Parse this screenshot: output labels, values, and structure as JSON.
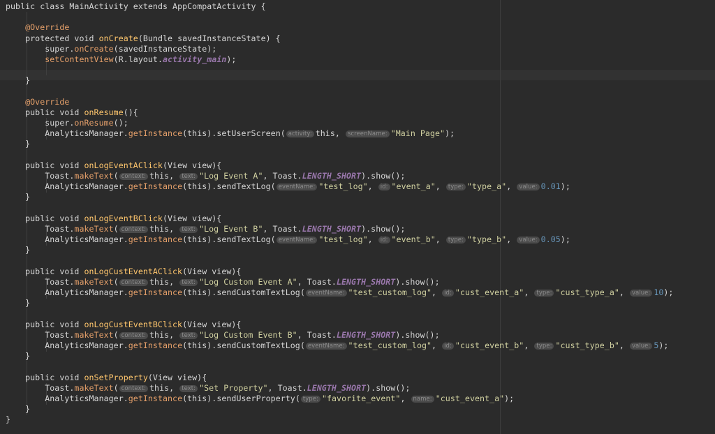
{
  "editor": {
    "lines": [
      [
        {
          "t": "public class ",
          "c": "kw"
        },
        {
          "t": "MainActivity",
          "c": "plain"
        },
        {
          "t": " extends ",
          "c": "kw"
        },
        {
          "t": "AppCompatActivity",
          "c": "plain"
        },
        {
          "t": " {",
          "c": "plain"
        }
      ],
      [],
      [
        {
          "t": "    "
        },
        {
          "t": "@Override",
          "c": "orange"
        }
      ],
      [
        {
          "t": "    protected void ",
          "c": "kw"
        },
        {
          "t": "onCreate",
          "c": "mth"
        },
        {
          "t": "(Bundle savedInstanceState) {",
          "c": "plain"
        }
      ],
      [
        {
          "t": "        super.",
          "c": "plain"
        },
        {
          "t": "onCreate",
          "c": "orange"
        },
        {
          "t": "(savedInstanceState);",
          "c": "plain"
        }
      ],
      [
        {
          "t": "        "
        },
        {
          "t": "setContentView",
          "c": "orange"
        },
        {
          "t": "(R.layout.",
          "c": "plain"
        },
        {
          "t": "activity_main",
          "c": "field"
        },
        {
          "t": ");",
          "c": "plain"
        }
      ],
      [],
      [
        {
          "t": "    }",
          "c": "plain"
        }
      ],
      [],
      [
        {
          "t": "    "
        },
        {
          "t": "@Override",
          "c": "orange"
        }
      ],
      [
        {
          "t": "    public void ",
          "c": "kw"
        },
        {
          "t": "onResume",
          "c": "mth"
        },
        {
          "t": "(){",
          "c": "plain"
        }
      ],
      [
        {
          "t": "        super.",
          "c": "plain"
        },
        {
          "t": "onResume",
          "c": "orange"
        },
        {
          "t": "();",
          "c": "plain"
        }
      ],
      [
        {
          "t": "        AnalyticsManager.",
          "c": "plain"
        },
        {
          "t": "getInstance",
          "c": "orange"
        },
        {
          "t": "(this).",
          "c": "plain"
        },
        {
          "t": "setUserScreen",
          "c": "plain"
        },
        {
          "t": "(",
          "c": "plain"
        },
        {
          "h": "activity:"
        },
        {
          "t": "this, ",
          "c": "plain"
        },
        {
          "h": "screenName:"
        },
        {
          "t": "\"Main Page\"",
          "c": "str"
        },
        {
          "t": ");",
          "c": "plain"
        }
      ],
      [
        {
          "t": "    }",
          "c": "plain"
        }
      ],
      [],
      [
        {
          "t": "    public void ",
          "c": "kw"
        },
        {
          "t": "onLogEventAClick",
          "c": "mth"
        },
        {
          "t": "(View view){",
          "c": "plain"
        }
      ],
      [
        {
          "t": "        Toast.",
          "c": "plain"
        },
        {
          "t": "makeText",
          "c": "orange"
        },
        {
          "t": "(",
          "c": "plain"
        },
        {
          "h": "context:"
        },
        {
          "t": "this, ",
          "c": "plain"
        },
        {
          "h": "text:"
        },
        {
          "t": "\"Log Event A\"",
          "c": "str"
        },
        {
          "t": ", Toast.",
          "c": "plain"
        },
        {
          "t": "LENGTH_SHORT",
          "c": "field"
        },
        {
          "t": ").show();",
          "c": "plain"
        }
      ],
      [
        {
          "t": "        AnalyticsManager.",
          "c": "plain"
        },
        {
          "t": "getInstance",
          "c": "orange"
        },
        {
          "t": "(this).",
          "c": "plain"
        },
        {
          "t": "sendTextLog",
          "c": "plain"
        },
        {
          "t": "(",
          "c": "plain"
        },
        {
          "h": "eventName:"
        },
        {
          "t": "\"test_log\"",
          "c": "str"
        },
        {
          "t": ", ",
          "c": "plain"
        },
        {
          "h": "id:"
        },
        {
          "t": "\"event_a\"",
          "c": "str"
        },
        {
          "t": ", ",
          "c": "plain"
        },
        {
          "h": "type:"
        },
        {
          "t": "\"type_a\"",
          "c": "str"
        },
        {
          "t": ", ",
          "c": "plain"
        },
        {
          "h": "value:"
        },
        {
          "t": "0.01",
          "c": "num"
        },
        {
          "t": ");",
          "c": "plain"
        }
      ],
      [
        {
          "t": "    }",
          "c": "plain"
        }
      ],
      [],
      [
        {
          "t": "    public void ",
          "c": "kw"
        },
        {
          "t": "onLogEventBClick",
          "c": "mth"
        },
        {
          "t": "(View view){",
          "c": "plain"
        }
      ],
      [
        {
          "t": "        Toast.",
          "c": "plain"
        },
        {
          "t": "makeText",
          "c": "orange"
        },
        {
          "t": "(",
          "c": "plain"
        },
        {
          "h": "context:"
        },
        {
          "t": "this, ",
          "c": "plain"
        },
        {
          "h": "text:"
        },
        {
          "t": "\"Log Event B\"",
          "c": "str"
        },
        {
          "t": ", Toast.",
          "c": "plain"
        },
        {
          "t": "LENGTH_SHORT",
          "c": "field"
        },
        {
          "t": ").show();",
          "c": "plain"
        }
      ],
      [
        {
          "t": "        AnalyticsManager.",
          "c": "plain"
        },
        {
          "t": "getInstance",
          "c": "orange"
        },
        {
          "t": "(this).",
          "c": "plain"
        },
        {
          "t": "sendTextLog",
          "c": "plain"
        },
        {
          "t": "(",
          "c": "plain"
        },
        {
          "h": "eventName:"
        },
        {
          "t": "\"test_log\"",
          "c": "str"
        },
        {
          "t": ", ",
          "c": "plain"
        },
        {
          "h": "id:"
        },
        {
          "t": "\"event_b\"",
          "c": "str"
        },
        {
          "t": ", ",
          "c": "plain"
        },
        {
          "h": "type:"
        },
        {
          "t": "\"type_b\"",
          "c": "str"
        },
        {
          "t": ", ",
          "c": "plain"
        },
        {
          "h": "value:"
        },
        {
          "t": "0.05",
          "c": "num"
        },
        {
          "t": ");",
          "c": "plain"
        }
      ],
      [
        {
          "t": "    }",
          "c": "plain"
        }
      ],
      [],
      [
        {
          "t": "    public void ",
          "c": "kw"
        },
        {
          "t": "onLogCustEventAClick",
          "c": "mth"
        },
        {
          "t": "(View view){",
          "c": "plain"
        }
      ],
      [
        {
          "t": "        Toast.",
          "c": "plain"
        },
        {
          "t": "makeText",
          "c": "orange"
        },
        {
          "t": "(",
          "c": "plain"
        },
        {
          "h": "context:"
        },
        {
          "t": "this, ",
          "c": "plain"
        },
        {
          "h": "text:"
        },
        {
          "t": "\"Log Custom Event A\"",
          "c": "str"
        },
        {
          "t": ", Toast.",
          "c": "plain"
        },
        {
          "t": "LENGTH_SHORT",
          "c": "field"
        },
        {
          "t": ").show();",
          "c": "plain"
        }
      ],
      [
        {
          "t": "        AnalyticsManager.",
          "c": "plain"
        },
        {
          "t": "getInstance",
          "c": "orange"
        },
        {
          "t": "(this).",
          "c": "plain"
        },
        {
          "t": "sendCustomTextLog",
          "c": "plain"
        },
        {
          "t": "(",
          "c": "plain"
        },
        {
          "h": "eventName:"
        },
        {
          "t": "\"test_custom_log\"",
          "c": "str"
        },
        {
          "t": ", ",
          "c": "plain"
        },
        {
          "h": "id:"
        },
        {
          "t": "\"cust_event_a\"",
          "c": "str"
        },
        {
          "t": ", ",
          "c": "plain"
        },
        {
          "h": "type:"
        },
        {
          "t": "\"cust_type_a\"",
          "c": "str"
        },
        {
          "t": ", ",
          "c": "plain"
        },
        {
          "h": "value:"
        },
        {
          "t": "10",
          "c": "num"
        },
        {
          "t": ");",
          "c": "plain"
        }
      ],
      [
        {
          "t": "    }",
          "c": "plain"
        }
      ],
      [],
      [
        {
          "t": "    public void ",
          "c": "kw"
        },
        {
          "t": "onLogCustEventBClick",
          "c": "mth"
        },
        {
          "t": "(View view){",
          "c": "plain"
        }
      ],
      [
        {
          "t": "        Toast.",
          "c": "plain"
        },
        {
          "t": "makeText",
          "c": "orange"
        },
        {
          "t": "(",
          "c": "plain"
        },
        {
          "h": "context:"
        },
        {
          "t": "this, ",
          "c": "plain"
        },
        {
          "h": "text:"
        },
        {
          "t": "\"Log Custom Event B\"",
          "c": "str"
        },
        {
          "t": ", Toast.",
          "c": "plain"
        },
        {
          "t": "LENGTH_SHORT",
          "c": "field"
        },
        {
          "t": ").show();",
          "c": "plain"
        }
      ],
      [
        {
          "t": "        AnalyticsManager.",
          "c": "plain"
        },
        {
          "t": "getInstance",
          "c": "orange"
        },
        {
          "t": "(this).",
          "c": "plain"
        },
        {
          "t": "sendCustomTextLog",
          "c": "plain"
        },
        {
          "t": "(",
          "c": "plain"
        },
        {
          "h": "eventName:"
        },
        {
          "t": "\"test_custom_log\"",
          "c": "str"
        },
        {
          "t": ", ",
          "c": "plain"
        },
        {
          "h": "id:"
        },
        {
          "t": "\"cust_event_b\"",
          "c": "str"
        },
        {
          "t": ", ",
          "c": "plain"
        },
        {
          "h": "type:"
        },
        {
          "t": "\"cust_type_b\"",
          "c": "str"
        },
        {
          "t": ", ",
          "c": "plain"
        },
        {
          "h": "value:"
        },
        {
          "t": "5",
          "c": "num"
        },
        {
          "t": ");",
          "c": "plain"
        }
      ],
      [
        {
          "t": "    }",
          "c": "plain"
        }
      ],
      [],
      [
        {
          "t": "    public void ",
          "c": "kw"
        },
        {
          "t": "onSetProperty",
          "c": "mth"
        },
        {
          "t": "(View view){",
          "c": "plain"
        }
      ],
      [
        {
          "t": "        Toast.",
          "c": "plain"
        },
        {
          "t": "makeText",
          "c": "orange"
        },
        {
          "t": "(",
          "c": "plain"
        },
        {
          "h": "context:"
        },
        {
          "t": "this, ",
          "c": "plain"
        },
        {
          "h": "text:"
        },
        {
          "t": "\"Set Property\"",
          "c": "str"
        },
        {
          "t": ", Toast.",
          "c": "plain"
        },
        {
          "t": "LENGTH_SHORT",
          "c": "field"
        },
        {
          "t": ").show();",
          "c": "plain"
        }
      ],
      [
        {
          "t": "        AnalyticsManager.",
          "c": "plain"
        },
        {
          "t": "getInstance",
          "c": "orange"
        },
        {
          "t": "(this).",
          "c": "plain"
        },
        {
          "t": "sendUserProperty",
          "c": "plain"
        },
        {
          "t": "(",
          "c": "plain"
        },
        {
          "h": "type:"
        },
        {
          "t": "\"favorite_event\"",
          "c": "str"
        },
        {
          "t": ", ",
          "c": "plain"
        },
        {
          "h": "name:"
        },
        {
          "t": "\"cust_event_a\"",
          "c": "str"
        },
        {
          "t": ");",
          "c": "plain"
        }
      ],
      [
        {
          "t": "    }",
          "c": "plain"
        }
      ],
      [
        {
          "t": "}",
          "c": "plain"
        }
      ]
    ]
  },
  "colors": {
    "background": "#2b2b2b",
    "current_line": "#323232",
    "method_declaration": "#ffc66d",
    "method_call": "#e6a06a",
    "string": "#d0d0a0",
    "number": "#6897bb",
    "constant": "#9876aa",
    "param_hint_bg": "#4b4b4b"
  }
}
